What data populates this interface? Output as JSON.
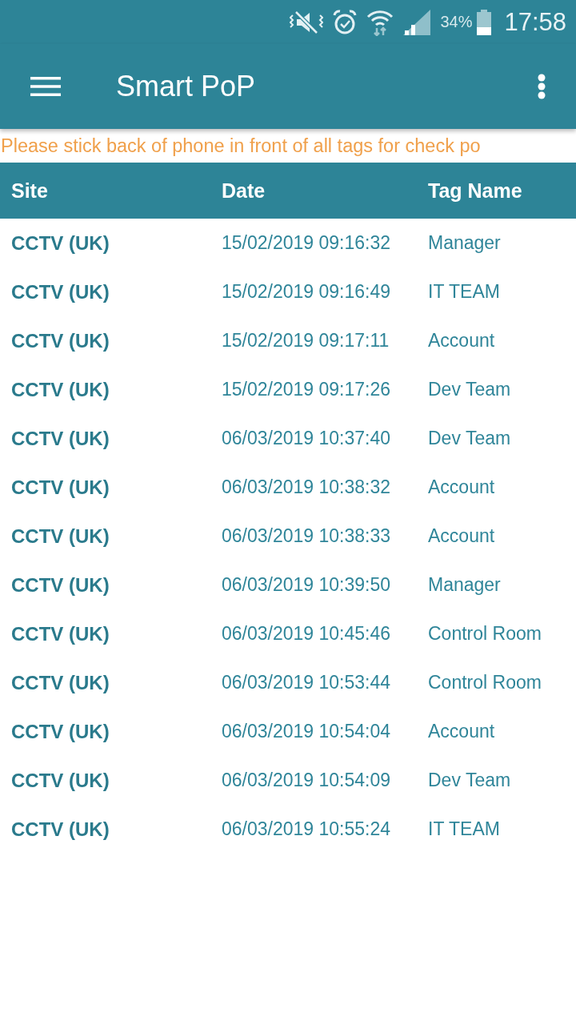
{
  "status_bar": {
    "battery_text": "34%",
    "time": "17:58"
  },
  "app_bar": {
    "title": "Smart PoP"
  },
  "notice": "Please stick back of phone in front of all tags for check po",
  "table": {
    "columns": [
      "Site",
      "Date",
      "Tag Name"
    ],
    "rows": [
      {
        "site": "CCTV (UK)",
        "date": "15/02/2019 09:16:32",
        "tag_name": "Manager"
      },
      {
        "site": "CCTV (UK)",
        "date": "15/02/2019 09:16:49",
        "tag_name": "IT TEAM"
      },
      {
        "site": "CCTV (UK)",
        "date": "15/02/2019 09:17:11",
        "tag_name": "Account"
      },
      {
        "site": "CCTV (UK)",
        "date": "15/02/2019 09:17:26",
        "tag_name": "Dev Team"
      },
      {
        "site": "CCTV (UK)",
        "date": "06/03/2019 10:37:40",
        "tag_name": "Dev Team"
      },
      {
        "site": "CCTV (UK)",
        "date": "06/03/2019 10:38:32",
        "tag_name": "Account"
      },
      {
        "site": "CCTV (UK)",
        "date": "06/03/2019 10:38:33",
        "tag_name": "Account"
      },
      {
        "site": "CCTV (UK)",
        "date": "06/03/2019 10:39:50",
        "tag_name": "Manager"
      },
      {
        "site": "CCTV (UK)",
        "date": "06/03/2019 10:45:46",
        "tag_name": "Control Room"
      },
      {
        "site": "CCTV (UK)",
        "date": "06/03/2019 10:53:44",
        "tag_name": "Control Room"
      },
      {
        "site": "CCTV (UK)",
        "date": "06/03/2019 10:54:04",
        "tag_name": "Account"
      },
      {
        "site": "CCTV (UK)",
        "date": "06/03/2019 10:54:09",
        "tag_name": "Dev Team"
      },
      {
        "site": "CCTV (UK)",
        "date": "06/03/2019 10:55:24",
        "tag_name": "IT TEAM"
      }
    ]
  }
}
